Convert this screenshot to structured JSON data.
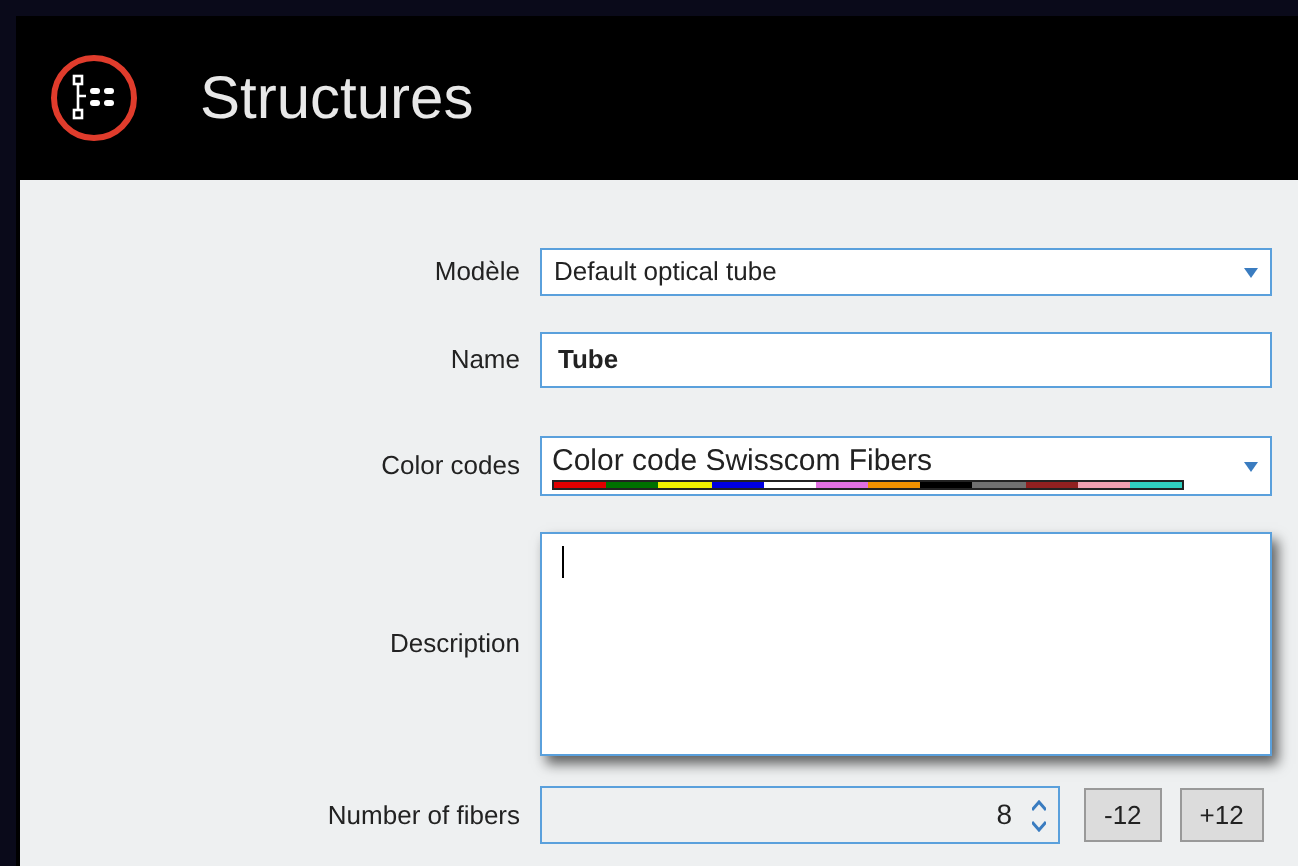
{
  "header": {
    "title": "Structures"
  },
  "form": {
    "model": {
      "label": "Modèle",
      "value": "Default optical tube"
    },
    "name": {
      "label": "Name",
      "value": "Tube"
    },
    "color_codes": {
      "label": "Color codes",
      "value": "Color code Swisscom Fibers",
      "colors": [
        {
          "color": "#e00000"
        },
        {
          "color": "#007000"
        },
        {
          "color": "#f0f000"
        },
        {
          "color": "#0000e0"
        },
        {
          "color": "#ffffff"
        },
        {
          "color": "#e070e0"
        },
        {
          "color": "#f09000"
        },
        {
          "color": "#000000"
        },
        {
          "color": "#707070"
        },
        {
          "color": "#902020"
        },
        {
          "color": "#f0a0b0"
        },
        {
          "color": "#30d0c0"
        }
      ]
    },
    "description": {
      "label": "Description",
      "focused": true
    },
    "fibers": {
      "label": "Number of fibers",
      "value": "8",
      "buttons": [
        "-12",
        "+12"
      ]
    }
  }
}
